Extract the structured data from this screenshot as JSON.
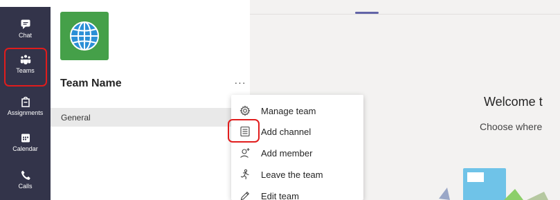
{
  "rail": {
    "items": [
      {
        "label": "Chat",
        "icon": "chat-icon"
      },
      {
        "label": "Teams",
        "icon": "teams-icon"
      },
      {
        "label": "Assignments",
        "icon": "assignments-icon"
      },
      {
        "label": "Calendar",
        "icon": "calendar-icon"
      },
      {
        "label": "Calls",
        "icon": "calls-icon"
      }
    ]
  },
  "team": {
    "name": "Team Name",
    "more": "···",
    "channels": [
      "General"
    ],
    "logo_icon": "globe-icon"
  },
  "menu": {
    "items": [
      {
        "label": "Manage team",
        "icon": "gear-icon"
      },
      {
        "label": "Add channel",
        "icon": "channel-icon"
      },
      {
        "label": "Add member",
        "icon": "add-person-icon"
      },
      {
        "label": "Leave the team",
        "icon": "leave-icon"
      },
      {
        "label": "Edit team",
        "icon": "pencil-icon"
      }
    ]
  },
  "main": {
    "welcome": "Welcome t",
    "choose": "Choose where"
  },
  "colors": {
    "rail_bg": "#33344a",
    "accent": "#6264a7",
    "highlight": "#e11c1c",
    "team_logo": "#45a049"
  }
}
